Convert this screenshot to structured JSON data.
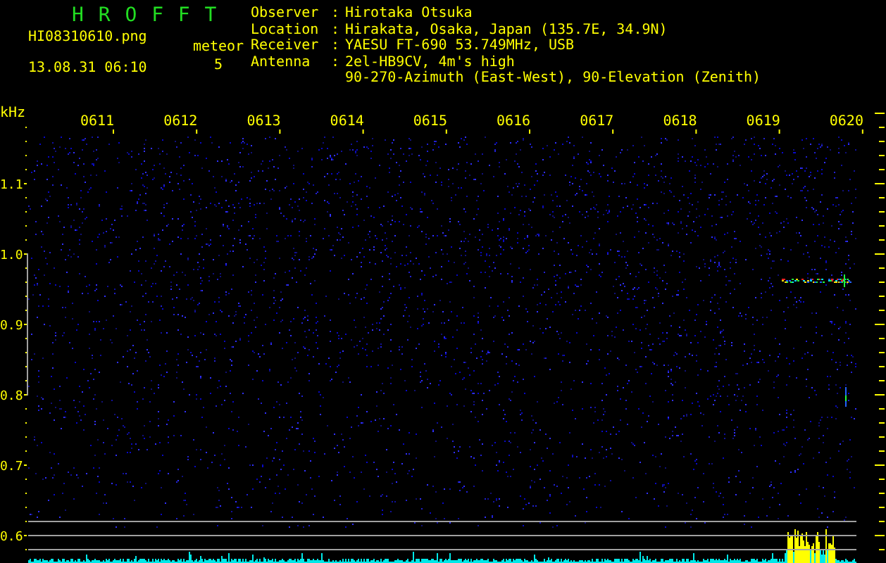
{
  "app_title": "H R O F F T",
  "file_name": "HI08310610.png",
  "timestamp": "13.08.31 06:10",
  "meteor_label": "meteor",
  "meteor_count": "5",
  "station_info": [
    {
      "label": "Observer",
      "separator": ":",
      "lines": [
        "Hirotaka Otsuka"
      ]
    },
    {
      "label": "Location",
      "separator": ":",
      "lines": [
        "Hirakata, Osaka, Japan (135.7E, 34.9N)"
      ]
    },
    {
      "label": "Receiver",
      "separator": ":",
      "lines": [
        "YAESU FT-690 53.749MHz, USB"
      ]
    },
    {
      "label": "Antenna",
      "separator": ":",
      "lines": [
        "2el-HB9CV, 4m's high",
        "90-270-Azimuth (East-West), 90-Elevation (Zenith)"
      ]
    }
  ],
  "plot": {
    "unit": "kHz",
    "time_labels": [
      "0611",
      "0612",
      "0613",
      "0614",
      "0615",
      "0616",
      "0617",
      "0618",
      "0619",
      "0620"
    ],
    "frequency_labels": [
      "1.1",
      "1.0",
      "0.9",
      "0.8",
      "0.7",
      "0.6"
    ]
  }
}
